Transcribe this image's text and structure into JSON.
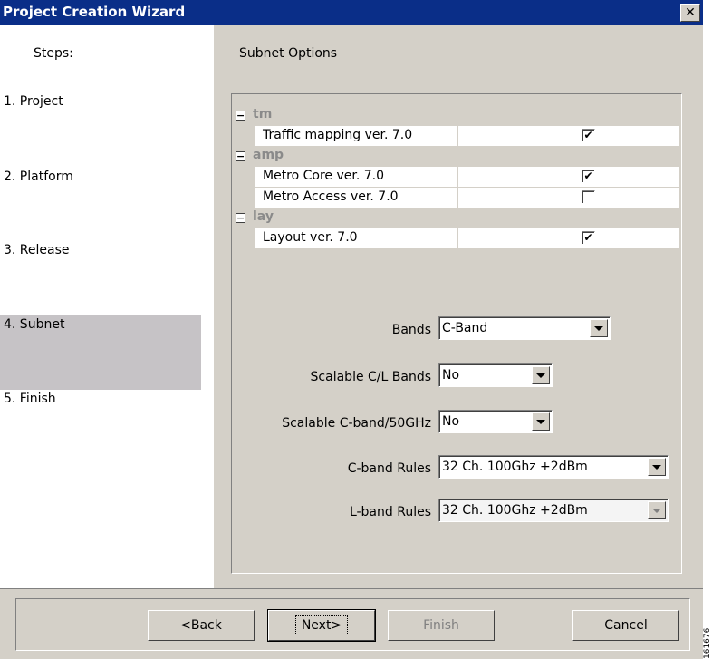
{
  "window": {
    "title": "Project Creation Wizard",
    "close_label": "✕"
  },
  "steps": {
    "heading": "Steps:",
    "items": [
      {
        "label": "1. Project"
      },
      {
        "label": "2. Platform"
      },
      {
        "label": "3. Release"
      },
      {
        "label": "4. Subnet",
        "active": true
      },
      {
        "label": "5. Finish"
      }
    ]
  },
  "main": {
    "heading": "Subnet Options",
    "groups": [
      {
        "name": "tm",
        "items": [
          {
            "label": "Traffic mapping ver. 7.0",
            "checked": true
          }
        ]
      },
      {
        "name": "amp",
        "items": [
          {
            "label": "Metro Core ver. 7.0",
            "checked": true
          },
          {
            "label": "Metro Access ver. 7.0",
            "checked": false
          }
        ]
      },
      {
        "name": "lay",
        "items": [
          {
            "label": "Layout ver. 7.0",
            "checked": true
          }
        ]
      }
    ],
    "fields": [
      {
        "label": "Bands",
        "value": "C-Band"
      },
      {
        "label": "Scalable C/L Bands",
        "value": "No"
      },
      {
        "label": "Scalable C-band/50GHz",
        "value": "No"
      },
      {
        "label": "C-band Rules",
        "value": "32 Ch. 100Ghz +2dBm"
      },
      {
        "label": "L-band Rules",
        "value": "32 Ch. 100Ghz +2dBm"
      }
    ]
  },
  "buttons": {
    "back": "<Back",
    "next": "Next>",
    "finish": "Finish",
    "cancel": "Cancel"
  },
  "figure_id": "161676",
  "icons": {
    "toggle": "collapse-icon",
    "checkbox": "check-icon",
    "dropdown": "chevron-down-icon"
  }
}
